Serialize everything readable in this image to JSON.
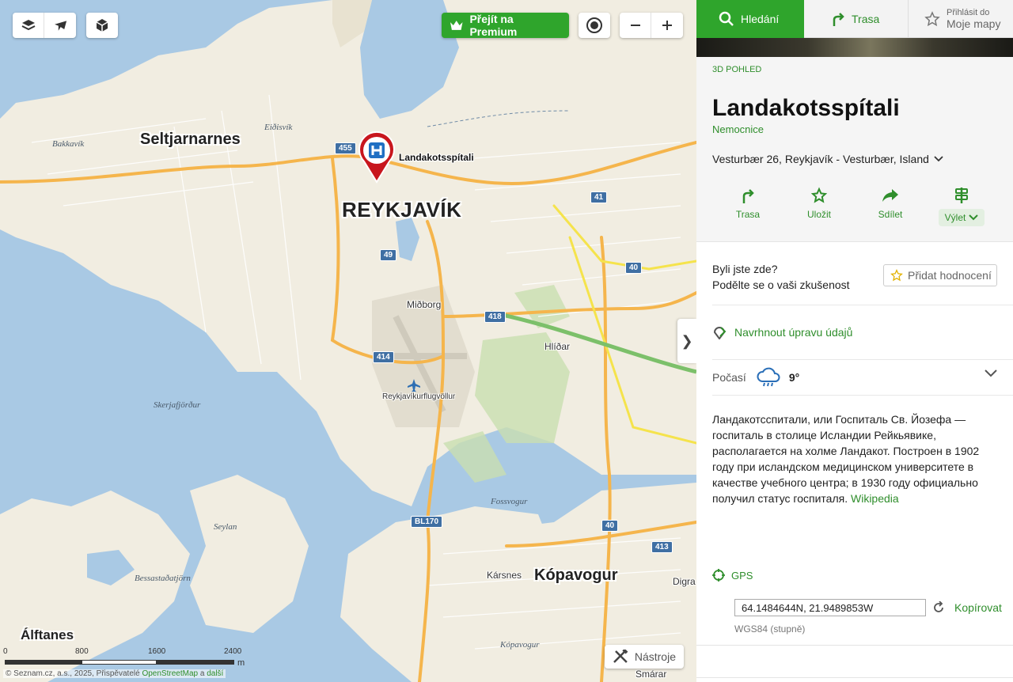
{
  "map": {
    "premium_label": "Přejít na Premium",
    "poi_label": "Landakotsspítali",
    "labels": {
      "reykjavik": "REYKJAVÍK",
      "seltjarnarnes": "Seltjarnarnes",
      "kopavogur": "Kópavogur",
      "alftanes": "Álftanes",
      "bakkavik": "Bakkavík",
      "eidisvik": "Eiðisvík",
      "midborg": "Miðborg",
      "hlidar": "Hlíðar",
      "airport": "Reykjavíkurflugvöllur",
      "skerjafjordur": "Skerjafjörður",
      "fossvogur": "Fossvogur",
      "seylan": "Seylan",
      "bessastadatjorn": "Bessastaðatjörn",
      "karsnes": "Kársnes",
      "kopavogur_water": "Kópavogur",
      "digra": "Digra",
      "smarar": "Smárar"
    },
    "roads": [
      "455",
      "49",
      "414",
      "418",
      "41",
      "40",
      "40",
      "413",
      "BL170"
    ],
    "collapse_glyph": "❯",
    "tools_label": "Nástroje",
    "scale": {
      "ticks": [
        "0",
        "800",
        "1600",
        "2400"
      ],
      "unit": "m"
    },
    "attribution": {
      "prefix": "© Seznam.cz, a.s., 2025, Přispěvatelé",
      "osm": "OpenStreetMap",
      "and": "a",
      "more": "další"
    }
  },
  "nav": {
    "search": "Hledání",
    "route": "Trasa",
    "login_small": "Přihlásit do",
    "login_big": "Moje mapy"
  },
  "poi": {
    "kicker": "3D POHLED",
    "title": "Landakotsspítali",
    "category": "Nemocnice",
    "address": "Vesturbær 26, Reykjavík - Vesturbær, Island"
  },
  "actions": {
    "route": "Trasa",
    "save": "Uložit",
    "share": "Sdílet",
    "trip": "Výlet"
  },
  "review": {
    "question": "Byli jste zde?",
    "prompt": "Podělte se o vaši zkušenost",
    "add": "Přidat hodnocení"
  },
  "suggest": "Navrhnout úpravu údajů",
  "weather": {
    "label": "Počasí",
    "temp": "9°"
  },
  "description": {
    "text": "Ландакотсспитали, или Госпиталь Св. Йозефа — госпиталь в столице Исландии Рейкьявике, располагается на холме Ландакот. Построен в 1902 году при исландском медицинском университете в качестве учебного центра; в 1930 году официально получил статус госпиталя.",
    "source": "Wikipedia"
  },
  "gps": {
    "label": "GPS",
    "value": "64.1484644N, 21.9489853W",
    "copy": "Kopírovat",
    "note": "WGS84 (stupně)"
  },
  "colors": {
    "accent": "#2fa52c",
    "water": "#a9c9e4",
    "land": "#f1ede1",
    "road_major": "#f5b54c"
  }
}
